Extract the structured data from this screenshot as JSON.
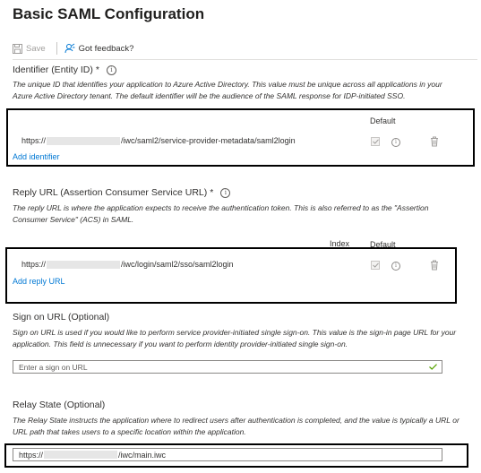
{
  "page": {
    "title": "Basic SAML Configuration"
  },
  "toolbar": {
    "save_label": "Save",
    "feedback_label": "Got feedback?"
  },
  "identifier": {
    "label": "Identifier (Entity ID)",
    "required_mark": "*",
    "description": "The unique ID that identifies your application to Azure Active Directory. This value must be unique across all applications in your Azure Active Directory tenant. The default identifier will be the audience of the SAML response for IDP-initiated SSO.",
    "default_header": "Default",
    "url_prefix": "https://",
    "url_suffix": "/iwc/saml2/service-provider-metadata/saml2login",
    "add_link": "Add identifier"
  },
  "reply": {
    "label": "Reply URL (Assertion Consumer Service URL)",
    "required_mark": "*",
    "description": "The reply URL is where the application expects to receive the authentication token. This is also referred to as the \"Assertion Consumer Service\" (ACS) in SAML.",
    "index_header": "Index",
    "default_header": "Default",
    "url_prefix": "https://",
    "url_suffix": "/iwc/login/saml2/sso/saml2login",
    "add_link": "Add reply URL"
  },
  "signon": {
    "label": "Sign on URL (Optional)",
    "description": "Sign on URL is used if you would like to perform service provider-initiated single sign-on. This value is the sign-in page URL for your application. This field is unnecessary if you want to perform identity provider-initiated single sign-on.",
    "placeholder": "Enter a sign on URL"
  },
  "relay": {
    "label": "Relay State (Optional)",
    "description": "The Relay State instructs the application where to redirect users after authentication is completed, and the value is typically a URL or URL path that takes users to a specific location within the application.",
    "url_prefix": "https://",
    "url_suffix": "/iwc/main.iwc"
  },
  "colors": {
    "accent": "#0078d4",
    "valid_check": "#57a300",
    "highlight_border": "#000000"
  }
}
